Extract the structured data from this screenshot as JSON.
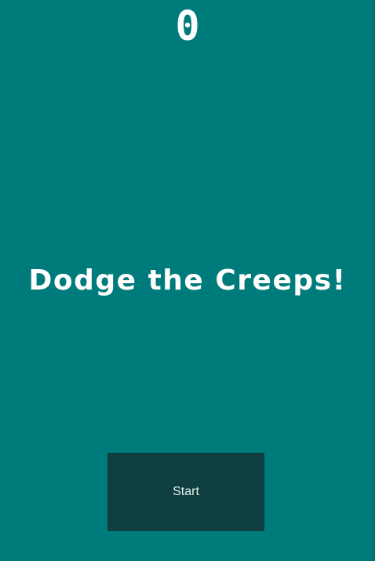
{
  "hud": {
    "score": "0"
  },
  "message": {
    "title": "Dodge the Creeps!"
  },
  "controls": {
    "start_label": "Start"
  },
  "colors": {
    "background": "#007b7b",
    "button": "#103f42",
    "text": "#ffffff"
  }
}
